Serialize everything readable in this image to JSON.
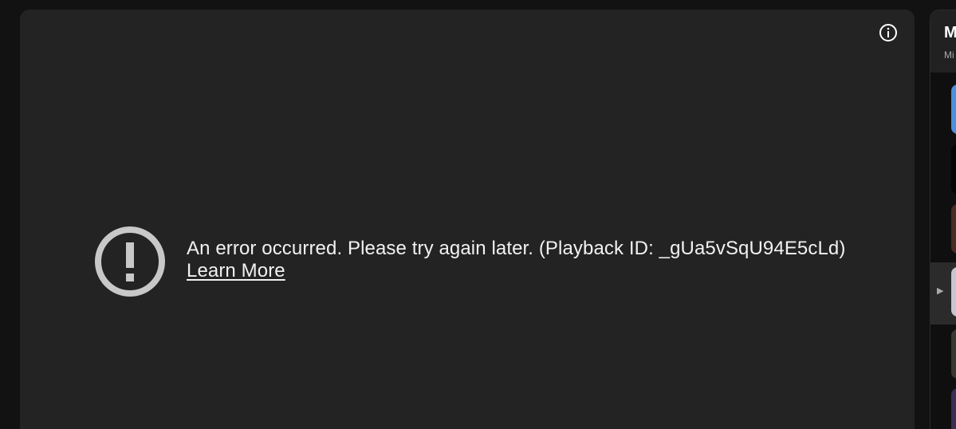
{
  "player": {
    "error_message": "An error occurred. Please try again later. (Playback ID: _gUa5vSqU94E5cLd)",
    "learn_more_label": "Learn More",
    "error_icon": "exclamation-circle-icon",
    "info_icon": "info-icon"
  },
  "playlist": {
    "title": "M",
    "subtitle": "Mi",
    "now_playing_marker": "▶",
    "items": [
      {
        "thumb_color": "#4a8fe0"
      },
      {
        "thumb_color": "#050505"
      },
      {
        "thumb_color": "#4a2a26"
      },
      {
        "thumb_color": "#c8c4d0"
      },
      {
        "thumb_color": "#3a3630"
      },
      {
        "thumb_color": "#3c2e52"
      }
    ]
  },
  "colors": {
    "background": "#121212",
    "player_background": "#232323",
    "text": "#f1f1f1",
    "icon_grey": "#c8c8c8"
  }
}
